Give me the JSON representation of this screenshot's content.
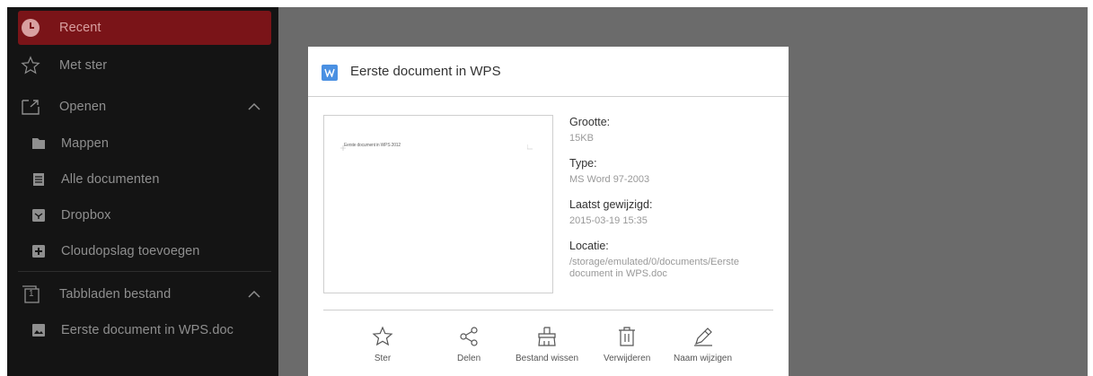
{
  "sidebar": {
    "items": [
      {
        "label": "Recent",
        "icon": "clock-icon",
        "active": true
      },
      {
        "label": "Met ster",
        "icon": "star-outline-icon"
      },
      {
        "label": "Openen",
        "icon": "open-folder-icon",
        "expanded": true
      },
      {
        "label": "Mappen",
        "icon": "folder-icon",
        "sub": true
      },
      {
        "label": "Alle documenten",
        "icon": "document-list-icon",
        "sub": true
      },
      {
        "label": "Dropbox",
        "icon": "dropbox-icon",
        "sub": true
      },
      {
        "label": "Cloudopslag toevoegen",
        "icon": "plus-box-icon",
        "sub": true
      },
      {
        "label": "Tabbladen bestand",
        "icon": "tab-counter-icon",
        "expanded": true,
        "tab_count": "1"
      },
      {
        "label": "Eerste document in WPS.doc",
        "icon": "image-doc-icon",
        "sub": true
      }
    ]
  },
  "dialog": {
    "title": "Eerste document in WPS",
    "preview_text": "Eerste document in WPS 2012",
    "info": {
      "size_label": "Grootte:",
      "size_value": "15KB",
      "type_label": "Type:",
      "type_value": "MS Word 97-2003",
      "modified_label": "Laatst gewijzigd:",
      "modified_value": "2015-03-19  15:35",
      "location_label": "Locatie:",
      "location_value": "/storage/emulated/0/documents/Eerste document in WPS.doc"
    },
    "actions": [
      {
        "label": "Ster",
        "icon": "star-icon"
      },
      {
        "label": "Delen",
        "icon": "share-icon"
      },
      {
        "label": "Bestand wissen",
        "icon": "clear-file-icon"
      },
      {
        "label": "Verwijderen",
        "icon": "trash-icon"
      },
      {
        "label": "Naam wijzigen",
        "icon": "pencil-icon"
      }
    ]
  },
  "colors": {
    "sidebar_bg": "#141414",
    "active_item_bg": "#7a1418",
    "overlay_bg": "#6b6b6b",
    "doc_badge": "#4a90e2"
  }
}
